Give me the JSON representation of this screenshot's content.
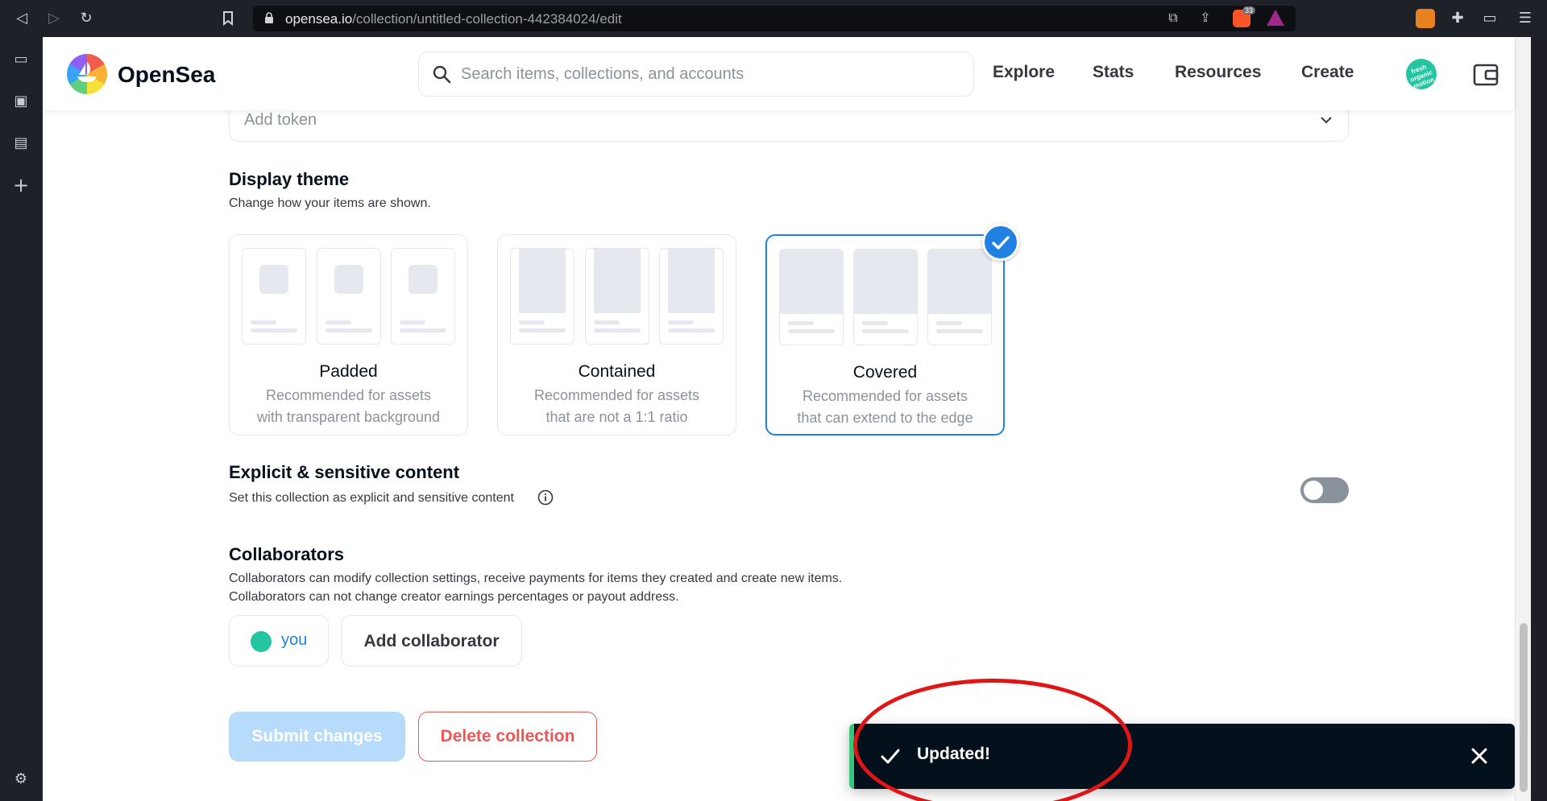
{
  "browser": {
    "url_host": "opensea.io",
    "url_path": "/collection/untitled-collection-442384024/edit",
    "brave_badge": "33"
  },
  "nav": {
    "logo_text": "OpenSea",
    "search_placeholder": "Search items, collections, and accounts",
    "links": [
      "Explore",
      "Stats",
      "Resources",
      "Create"
    ],
    "avatar_text": "fresh organic motion"
  },
  "token": {
    "placeholder": "Add token"
  },
  "display_theme": {
    "title": "Display theme",
    "description": "Change how your items are shown.",
    "selected": "Covered",
    "options": [
      {
        "title": "Padded",
        "line1": "Recommended for assets",
        "line2": "with transparent background"
      },
      {
        "title": "Contained",
        "line1": "Recommended for assets",
        "line2": "that are not a 1:1 ratio"
      },
      {
        "title": "Covered",
        "line1": "Recommended for assets",
        "line2": "that can extend to the edge"
      }
    ]
  },
  "explicit": {
    "title": "Explicit & sensitive content",
    "description": "Set this collection as explicit and sensitive content",
    "enabled": false
  },
  "collaborators": {
    "title": "Collaborators",
    "line1": "Collaborators can modify collection settings, receive payments for items they created and create new items.",
    "line2": "Collaborators can not change creator earnings percentages or payout address.",
    "you_label": "you",
    "add_label": "Add collaborator"
  },
  "actions": {
    "submit_label": "Submit changes",
    "delete_label": "Delete collection"
  },
  "toast": {
    "message": "Updated!"
  },
  "colors": {
    "accent": "#2081e2",
    "danger": "#eb5757",
    "toast_bg": "#04111d",
    "success": "#34c77b",
    "annotation": "#e01515"
  }
}
